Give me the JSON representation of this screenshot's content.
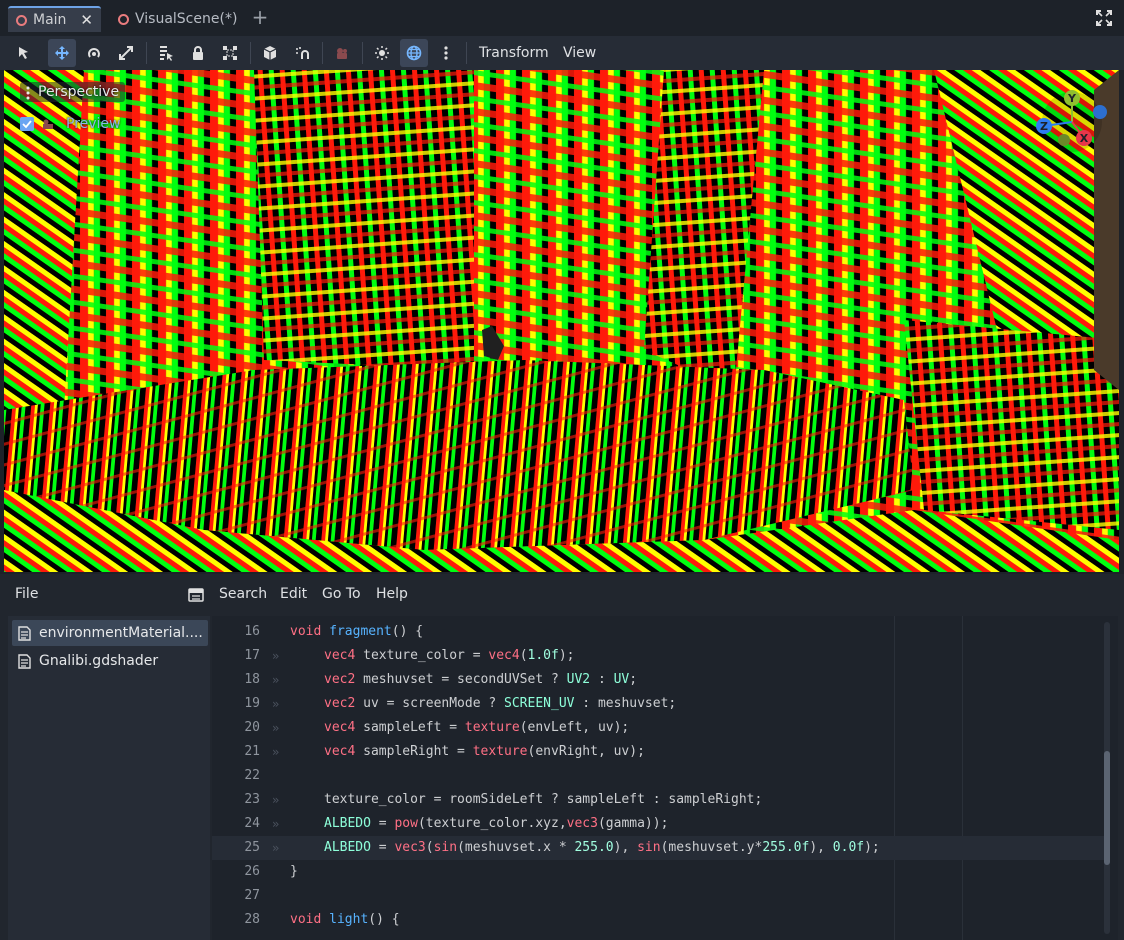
{
  "scene_tabs": {
    "tabs": [
      {
        "label": "Main",
        "active": true
      },
      {
        "label": "VisualScene(*)",
        "active": false
      }
    ],
    "add_tab": "+"
  },
  "toolbar": {
    "menus": [
      "Transform",
      "View"
    ],
    "tools": [
      "select-tool",
      "move-tool",
      "rotate-tool",
      "scale-tool",
      "list-select-tool",
      "lock-tool",
      "group-tool",
      "local-space-tool",
      "snap-tool",
      "camera-tool",
      "sun-preview",
      "environment-preview",
      "more-options"
    ]
  },
  "viewport": {
    "perspective_label": "Perspective",
    "preview_label": "Preview",
    "preview_checked": true,
    "gizmo_axes": [
      "Y",
      "Z",
      "X"
    ],
    "stripe_colors": [
      "#ff1a0a",
      "#00ff10",
      "#ffff00",
      "#000000"
    ]
  },
  "script_menu": {
    "file": "File",
    "search": "Search",
    "edit": "Edit",
    "goto": "Go To",
    "help": "Help"
  },
  "script_list": [
    {
      "label": "environmentMaterial....",
      "selected": true
    },
    {
      "label": "Gnalibi.gdshader",
      "selected": false
    }
  ],
  "code_lines": [
    {
      "num": "16",
      "tab": false,
      "tokens": [
        [
          "kw",
          "void"
        ],
        [
          "tok",
          " "
        ],
        [
          "fn",
          "fragment"
        ],
        [
          "tok",
          "() {"
        ]
      ]
    },
    {
      "num": "17",
      "tab": true,
      "tokens": [
        [
          "kw",
          "vec4"
        ],
        [
          "tok",
          " texture_color = "
        ],
        [
          "kw",
          "vec4"
        ],
        [
          "tok",
          "("
        ],
        [
          "nm",
          "1.0f"
        ],
        [
          "tok",
          ");"
        ]
      ]
    },
    {
      "num": "18",
      "tab": true,
      "tokens": [
        [
          "kw",
          "vec2"
        ],
        [
          "tok",
          " meshuvset = secondUVSet ? "
        ],
        [
          "ty",
          "UV2"
        ],
        [
          "tok",
          " : "
        ],
        [
          "ty",
          "UV"
        ],
        [
          "tok",
          ";"
        ]
      ]
    },
    {
      "num": "19",
      "tab": true,
      "tokens": [
        [
          "kw",
          "vec2"
        ],
        [
          "tok",
          " uv = screenMode ? "
        ],
        [
          "ty",
          "SCREEN_UV"
        ],
        [
          "tok",
          " : meshuvset;"
        ]
      ]
    },
    {
      "num": "20",
      "tab": true,
      "tokens": [
        [
          "kw",
          "vec4"
        ],
        [
          "tok",
          " sampleLeft = "
        ],
        [
          "kw",
          "texture"
        ],
        [
          "tok",
          "(envLeft, uv);"
        ]
      ]
    },
    {
      "num": "21",
      "tab": true,
      "tokens": [
        [
          "kw",
          "vec4"
        ],
        [
          "tok",
          " sampleRight = "
        ],
        [
          "kw",
          "texture"
        ],
        [
          "tok",
          "(envRight, uv);"
        ]
      ]
    },
    {
      "num": "22",
      "tab": false,
      "tokens": []
    },
    {
      "num": "23",
      "tab": true,
      "tokens": [
        [
          "tok",
          "texture_color = roomSideLeft ? sampleLeft : sampleRight;"
        ]
      ]
    },
    {
      "num": "24",
      "tab": true,
      "tokens": [
        [
          "ty",
          "ALBEDO"
        ],
        [
          "tok",
          " = "
        ],
        [
          "kw",
          "pow"
        ],
        [
          "tok",
          "(texture_color.xyz,"
        ],
        [
          "kw",
          "vec3"
        ],
        [
          "tok",
          "(gamma));"
        ]
      ]
    },
    {
      "num": "25",
      "tab": true,
      "current": true,
      "tokens": [
        [
          "ty",
          "ALBEDO"
        ],
        [
          "tok",
          " = "
        ],
        [
          "kw",
          "vec3"
        ],
        [
          "tok",
          "("
        ],
        [
          "kw",
          "sin"
        ],
        [
          "tok",
          "(meshuvset.x * "
        ],
        [
          "nm",
          "255.0"
        ],
        [
          "tok",
          "), "
        ],
        [
          "kw",
          "sin"
        ],
        [
          "tok",
          "(meshuvset.y*"
        ],
        [
          "nm",
          "255.0f"
        ],
        [
          "tok",
          "), "
        ],
        [
          "nm",
          "0.0f"
        ],
        [
          "tok",
          ");"
        ]
      ]
    },
    {
      "num": "26",
      "tab": false,
      "tokens": [
        [
          "tok",
          "}"
        ]
      ]
    },
    {
      "num": "27",
      "tab": false,
      "tokens": []
    },
    {
      "num": "28",
      "tab": false,
      "tokens": [
        [
          "kw",
          "void"
        ],
        [
          "tok",
          " "
        ],
        [
          "fn",
          "light"
        ],
        [
          "tok",
          "() {"
        ]
      ]
    }
  ]
}
